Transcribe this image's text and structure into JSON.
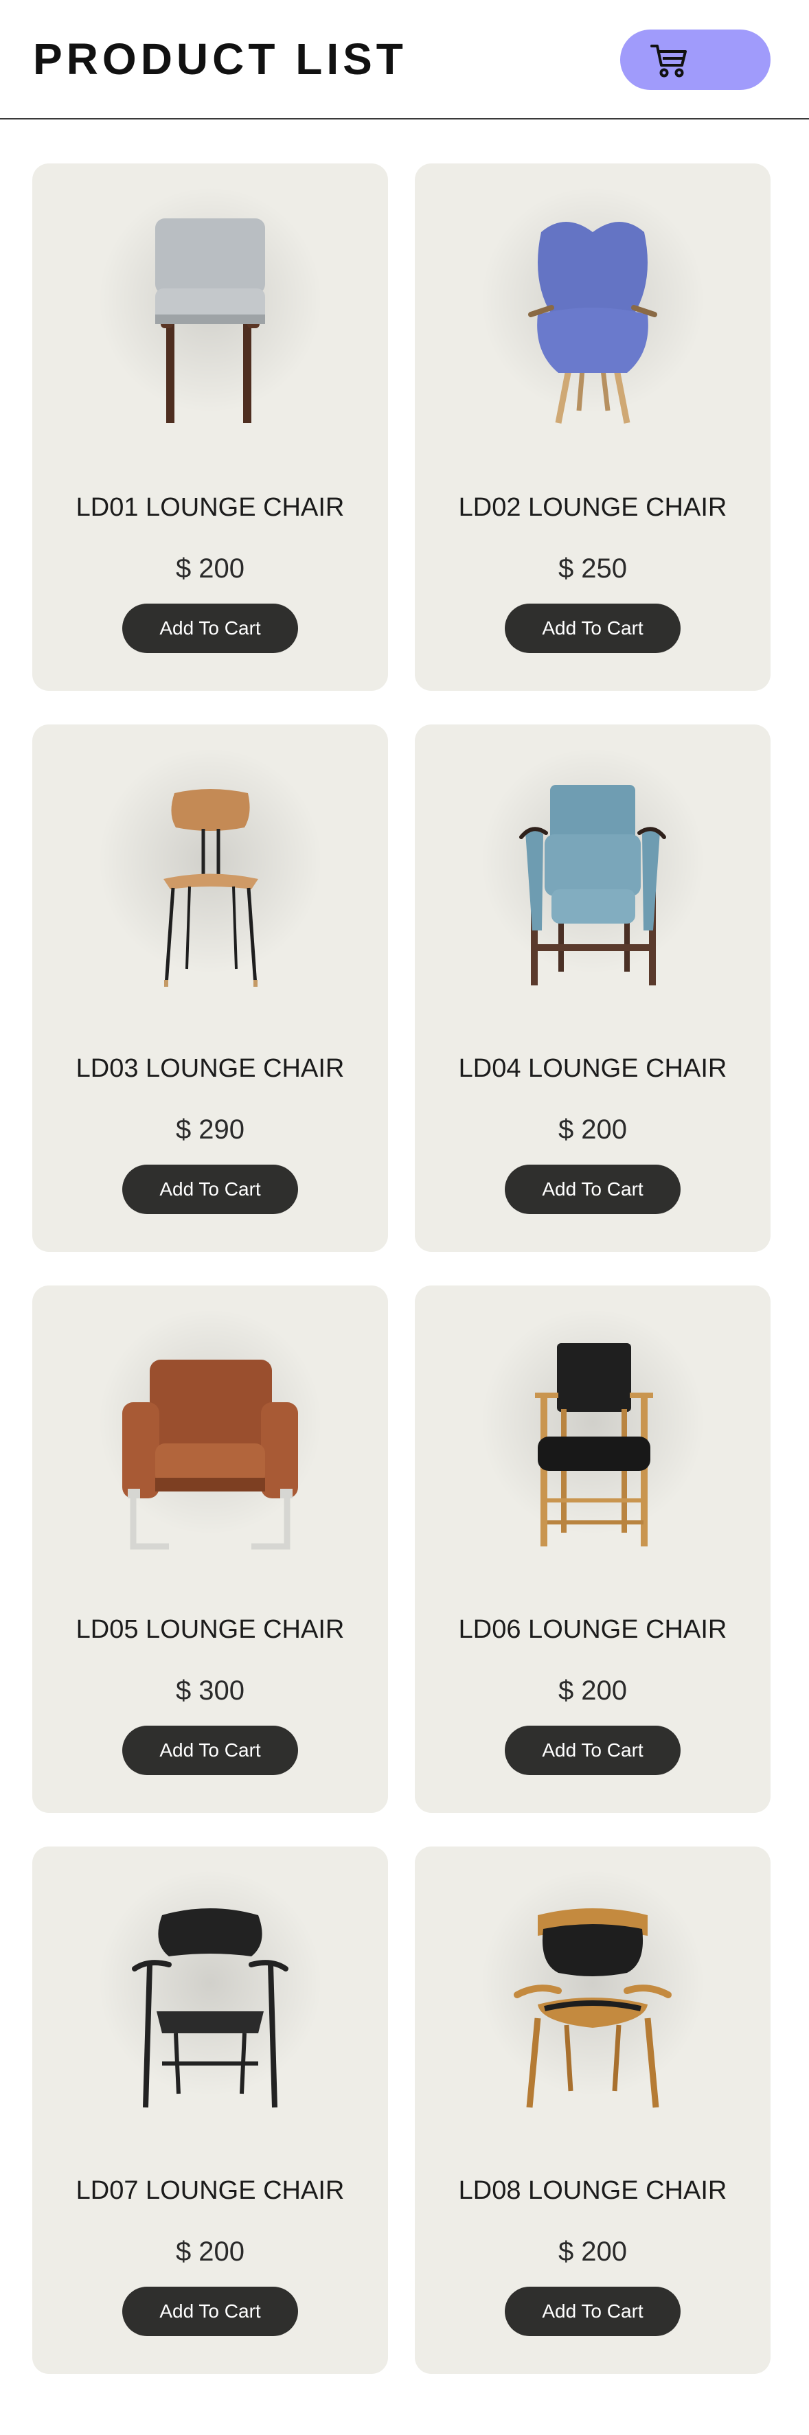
{
  "header": {
    "title": "PRODUCT LIST",
    "cart_icon": "shopping-cart-icon",
    "accent_color": "#a09bfb"
  },
  "products": [
    {
      "name": "LD01 LOUNGE CHAIR",
      "price": "$ 200",
      "button_label": "Add To Cart",
      "image": "lounge-chair-grey-image"
    },
    {
      "name": "LD02 LOUNGE CHAIR",
      "price": "$ 250",
      "button_label": "Add To Cart",
      "image": "wingback-chair-blue-image"
    },
    {
      "name": "LD03 LOUNGE CHAIR",
      "price": "$ 290",
      "button_label": "Add To Cart",
      "image": "wood-side-chair-image"
    },
    {
      "name": "LD04 LOUNGE CHAIR",
      "price": "$ 200",
      "button_label": "Add To Cart",
      "image": "armchair-teal-image"
    },
    {
      "name": "LD05 LOUNGE CHAIR",
      "price": "$ 300",
      "button_label": "Add To Cart",
      "image": "leather-armchair-brown-image"
    },
    {
      "name": "LD06 LOUNGE CHAIR",
      "price": "$ 200",
      "button_label": "Add To Cart",
      "image": "black-seat-wood-chair-image"
    },
    {
      "name": "LD07 LOUNGE CHAIR",
      "price": "$ 200",
      "button_label": "Add To Cart",
      "image": "black-wishbone-chair-image"
    },
    {
      "name": "LD08 LOUNGE CHAIR",
      "price": "$ 200",
      "button_label": "Add To Cart",
      "image": "oak-shell-chair-image"
    }
  ]
}
